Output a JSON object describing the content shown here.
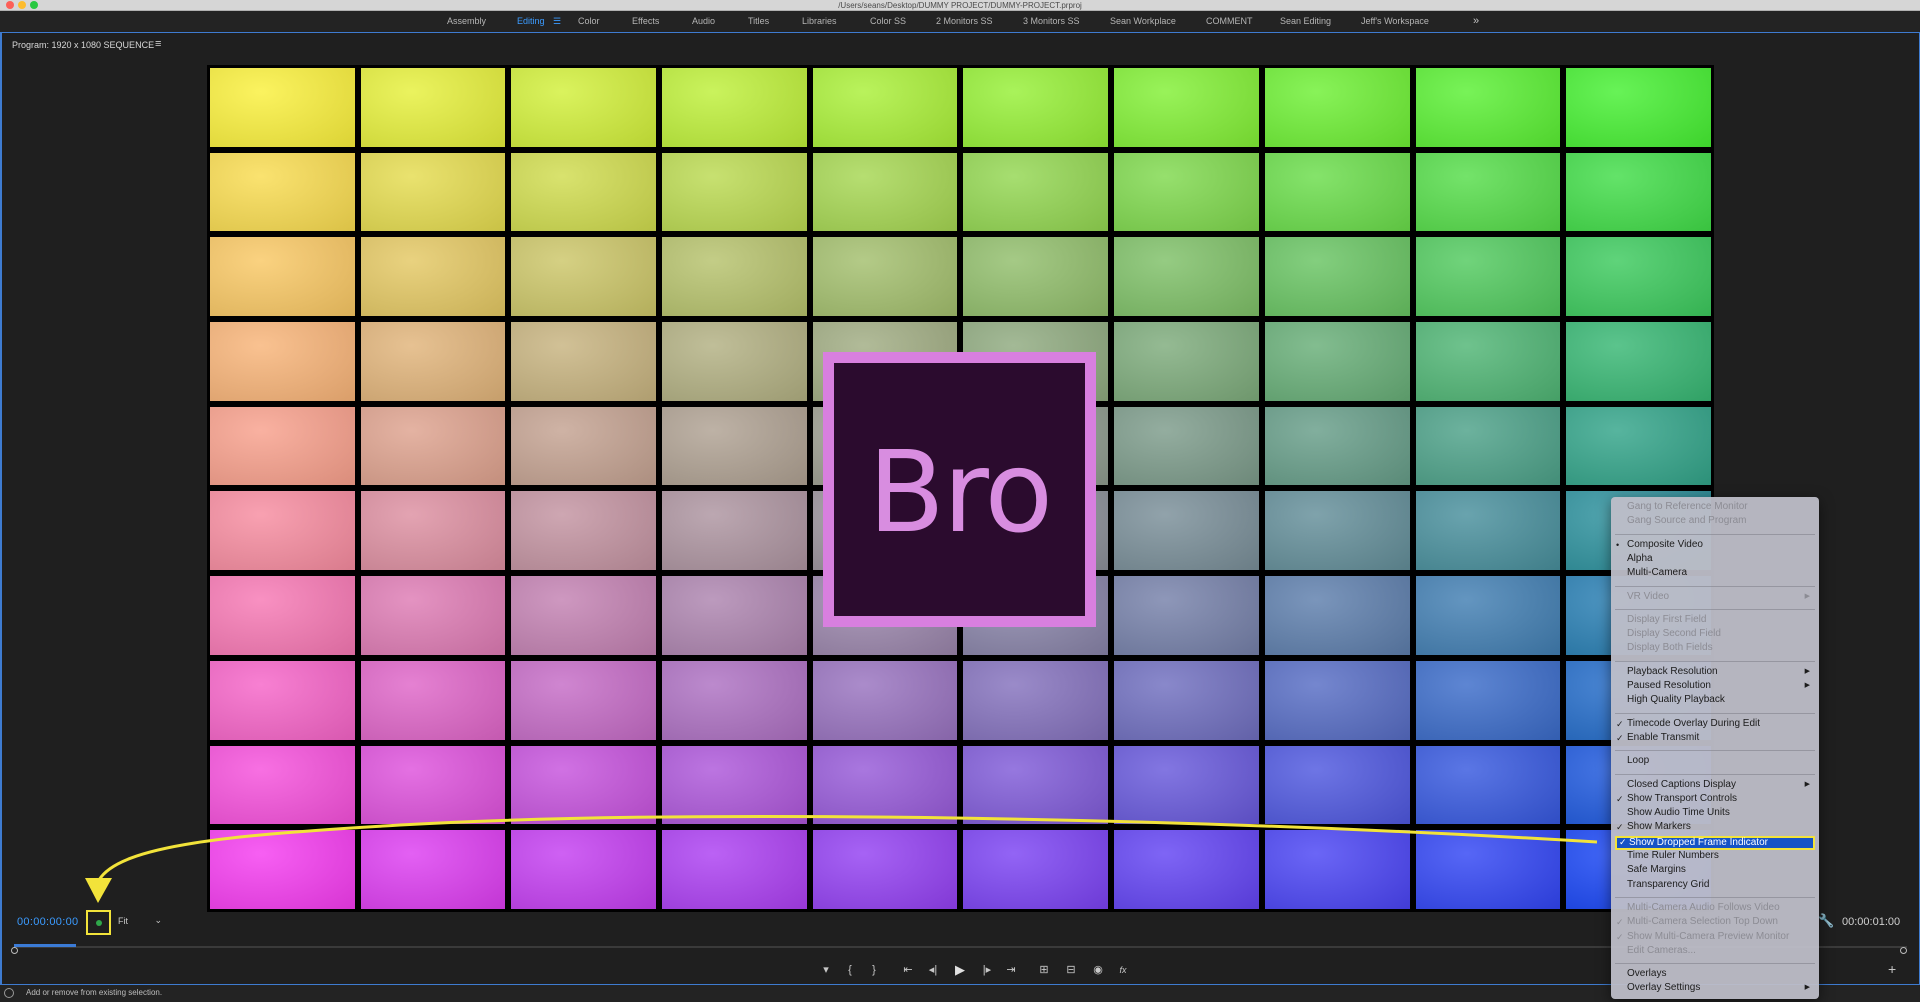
{
  "window": {
    "title": "/Users/seans/Desktop/DUMMY PROJECT/DUMMY-PROJECT.prproj"
  },
  "workspaces": {
    "tabs": [
      "Assembly",
      "Editing",
      "Color",
      "Effects",
      "Audio",
      "Titles",
      "Libraries",
      "Color SS",
      "2 Monitors SS",
      "3 Monitors SS",
      "Sean Workplace",
      "COMMENT",
      "Sean Editing",
      "Jeff's Workspace"
    ],
    "active": "Editing",
    "more_icon": "chevron-double-right-icon",
    "menu_icon": "hamburger-icon"
  },
  "panel": {
    "header": "Program: 1920 x 1080 SEQUENCE",
    "menu_icon": "hamburger-icon"
  },
  "video": {
    "logo_text": "Bro",
    "grid_rows": 10,
    "grid_cols": 10
  },
  "controls": {
    "timecode": "00:00:00:00",
    "zoom": "Fit",
    "end_timecode": "00:00:01:00",
    "accent": "#3b9bff",
    "highlight_color": "#f2e33a"
  },
  "transport_icons": [
    "add-marker-icon",
    "mark-in-icon",
    "mark-out-icon",
    "go-to-in-icon",
    "step-back-icon",
    "play-icon",
    "step-forward-icon",
    "go-to-out-icon",
    "lift-icon",
    "extract-icon",
    "export-frame-icon",
    "fx-icon"
  ],
  "transport_glyphs": [
    "▾",
    "{",
    "}",
    "⇤",
    "◂|",
    "▶",
    "|▸",
    "⇥",
    "⊞",
    "⊟",
    "◉",
    "fx"
  ],
  "status": {
    "text": "Add or remove from existing selection."
  },
  "context_menu": {
    "groups": [
      [
        {
          "label": "Gang to Reference Monitor",
          "disabled": true
        },
        {
          "label": "Gang Source and Program",
          "disabled": true
        }
      ],
      [
        {
          "label": "Composite Video",
          "mark": "•"
        },
        {
          "label": "Alpha"
        },
        {
          "label": "Multi-Camera"
        }
      ],
      [
        {
          "label": "VR Video",
          "disabled": true,
          "submenu": true
        }
      ],
      [
        {
          "label": "Display First Field",
          "disabled": true
        },
        {
          "label": "Display Second Field",
          "disabled": true
        },
        {
          "label": "Display Both Fields",
          "disabled": true
        }
      ],
      [
        {
          "label": "Playback Resolution",
          "submenu": true
        },
        {
          "label": "Paused Resolution",
          "submenu": true
        },
        {
          "label": "High Quality Playback"
        }
      ],
      [
        {
          "label": "Timecode Overlay During Edit",
          "mark": "✓"
        },
        {
          "label": "Enable Transmit",
          "mark": "✓"
        }
      ],
      [
        {
          "label": "Loop"
        }
      ],
      [
        {
          "label": "Closed Captions Display",
          "submenu": true
        },
        {
          "label": "Show Transport Controls",
          "mark": "✓"
        },
        {
          "label": "Show Audio Time Units"
        },
        {
          "label": "Show Markers",
          "mark": "✓"
        },
        {
          "label": "Show Dropped Frame Indicator",
          "mark": "✓",
          "highlighted": true
        },
        {
          "label": "Time Ruler Numbers"
        },
        {
          "label": "Safe Margins"
        },
        {
          "label": "Transparency Grid"
        }
      ],
      [
        {
          "label": "Multi-Camera Audio Follows Video",
          "disabled": true
        },
        {
          "label": "Multi-Camera Selection Top Down",
          "mark": "✓",
          "disabled": true
        },
        {
          "label": "Show Multi-Camera Preview Monitor",
          "mark": "✓",
          "disabled": true
        },
        {
          "label": "Edit Cameras...",
          "disabled": true
        }
      ],
      [
        {
          "label": "Overlays"
        },
        {
          "label": "Overlay Settings",
          "submenu": true
        }
      ]
    ]
  }
}
